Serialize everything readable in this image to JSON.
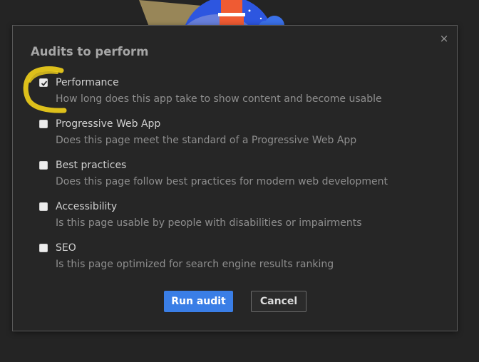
{
  "dialog": {
    "title": "Audits to perform",
    "close_glyph": "×"
  },
  "audits": [
    {
      "label": "Performance",
      "description": "How long does this app take to show content and become usable",
      "checked": true
    },
    {
      "label": "Progressive Web App",
      "description": "Does this page meet the standard of a Progressive Web App",
      "checked": false
    },
    {
      "label": "Best practices",
      "description": "Does this page follow best practices for modern web development",
      "checked": false
    },
    {
      "label": "Accessibility",
      "description": "Is this page usable by people with disabilities or impairments",
      "checked": false
    },
    {
      "label": "SEO",
      "description": "Is this page optimized for search engine results ranking",
      "checked": false
    }
  ],
  "buttons": {
    "run_label": "Run audit",
    "cancel_label": "Cancel"
  },
  "colors": {
    "accent": "#3a7ee6",
    "highlight": "#f2d21b"
  }
}
